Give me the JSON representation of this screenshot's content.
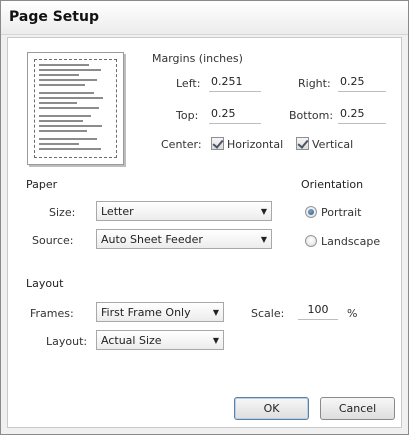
{
  "window": {
    "title": "Page Setup"
  },
  "margins": {
    "group_label": "Margins (inches)",
    "left_label": "Left:",
    "left_value": "0.251",
    "right_label": "Right:",
    "right_value": "0.25",
    "top_label": "Top:",
    "top_value": "0.25",
    "bottom_label": "Bottom:",
    "bottom_value": "0.25",
    "center_label": "Center:",
    "horizontal_label": "Horizontal",
    "horizontal_checked": true,
    "vertical_label": "Vertical",
    "vertical_checked": true
  },
  "paper": {
    "group_label": "Paper",
    "size_label": "Size:",
    "size_value": "Letter",
    "source_label": "Source:",
    "source_value": "Auto Sheet Feeder"
  },
  "orientation": {
    "group_label": "Orientation",
    "portrait_label": "Portrait",
    "landscape_label": "Landscape",
    "selected": "Portrait"
  },
  "layout": {
    "group_label": "Layout",
    "frames_label": "Frames:",
    "frames_value": "First Frame Only",
    "layout_label": "Layout:",
    "layout_value": "Actual Size",
    "scale_label": "Scale:",
    "scale_value": "100",
    "scale_unit": "%"
  },
  "buttons": {
    "ok": "OK",
    "cancel": "Cancel"
  }
}
